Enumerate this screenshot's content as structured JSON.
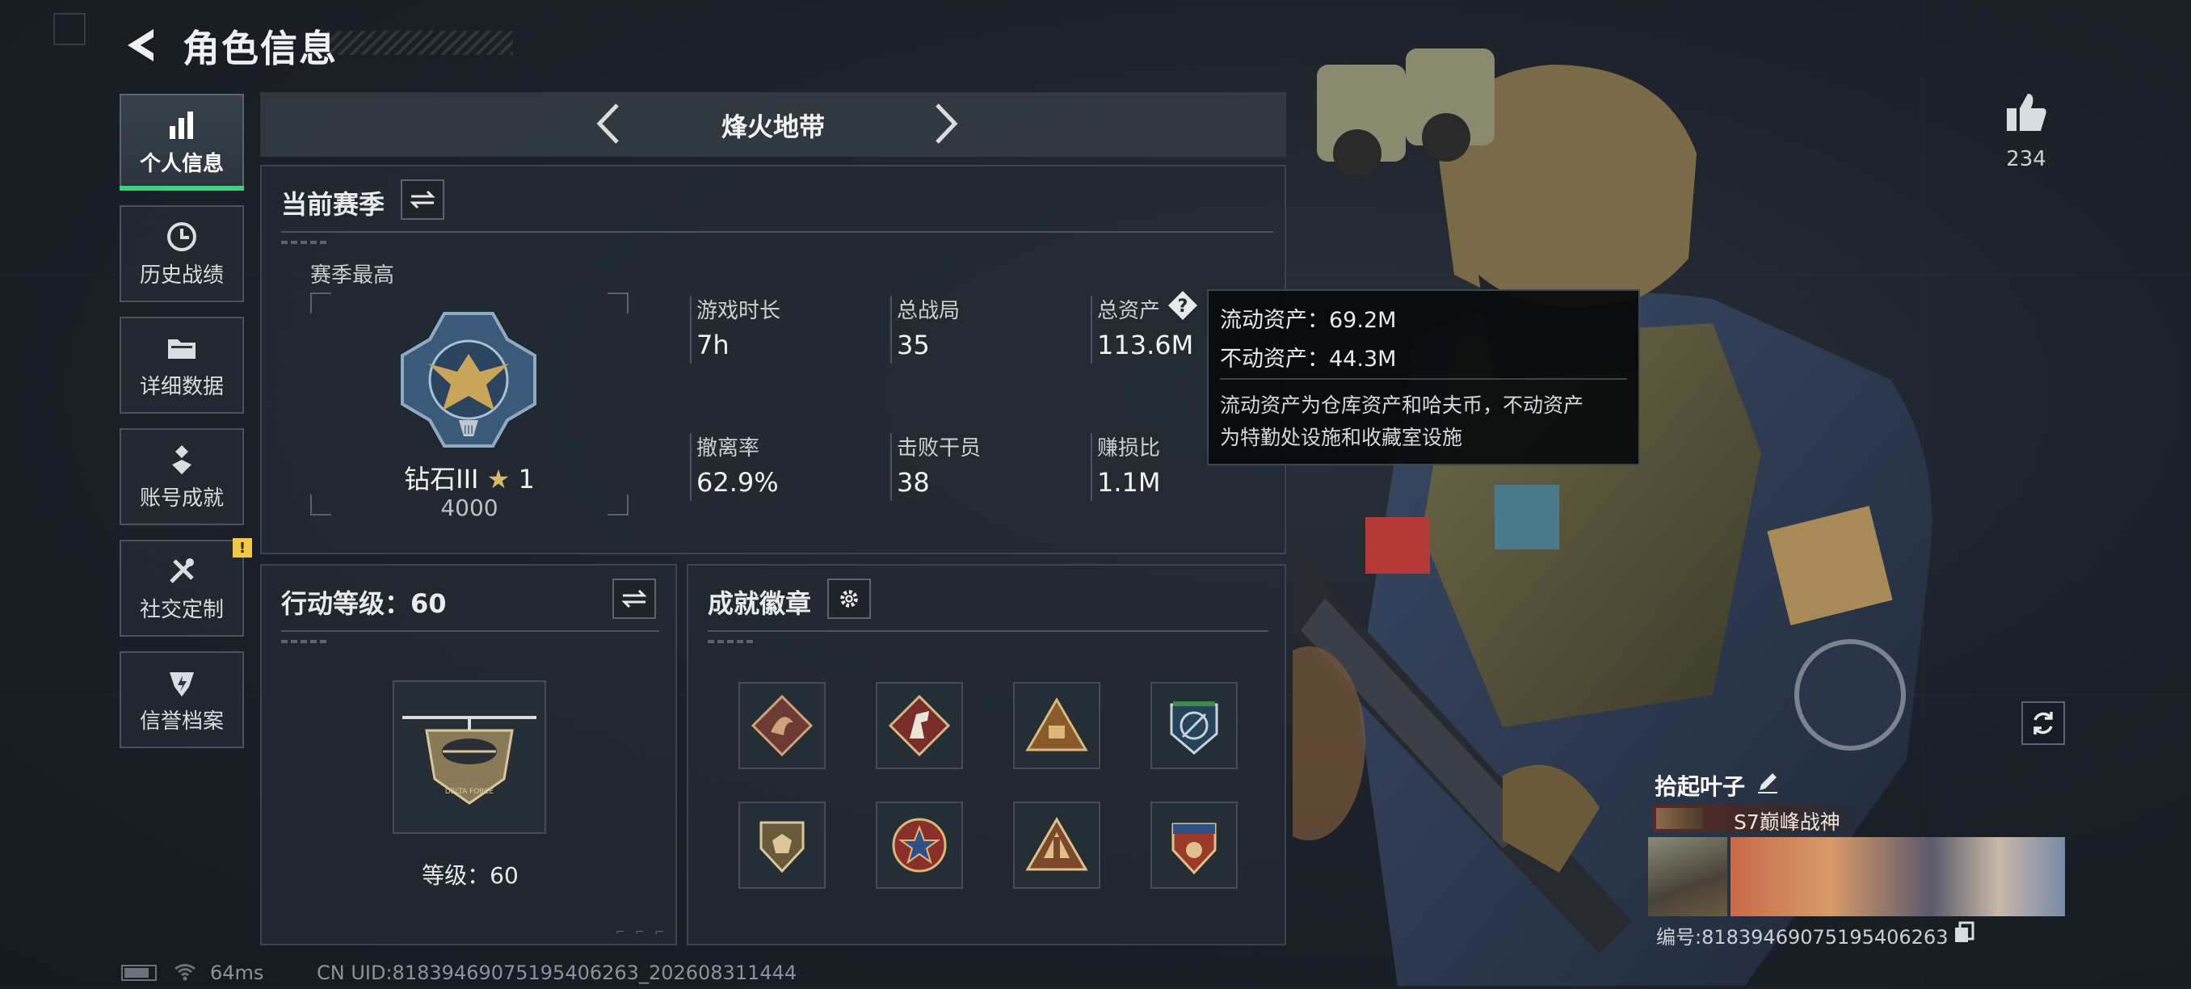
{
  "header": {
    "title": "角色信息"
  },
  "nav": [
    {
      "label": "个人信息",
      "icon": "bar-chart-icon",
      "active": true
    },
    {
      "label": "历史战绩",
      "icon": "clock-icon"
    },
    {
      "label": "详细数据",
      "icon": "folder-icon"
    },
    {
      "label": "账号成就",
      "icon": "achievement-icon"
    },
    {
      "label": "社交定制",
      "icon": "tools-icon",
      "badge": "!"
    },
    {
      "label": "信誉档案",
      "icon": "shield-bolt-icon"
    }
  ],
  "mode": {
    "name": "烽火地带"
  },
  "season": {
    "title": "当前赛季",
    "best_label": "赛季最高",
    "rank_name": "钻石III",
    "rank_stars": "1",
    "rank_score": "4000",
    "stats": [
      {
        "label": "游戏时长",
        "value": "7h"
      },
      {
        "label": "总战局",
        "value": "35"
      },
      {
        "label": "总资产",
        "value": "113.6M"
      },
      {
        "label": "撤离率",
        "value": "62.9%"
      },
      {
        "label": "击败干员",
        "value": "38"
      },
      {
        "label": "赚损比",
        "value": "1.1M"
      }
    ],
    "help_icon": "?"
  },
  "tooltip": {
    "line1": "流动资产：69.2M",
    "line2": "不动资产：44.3M",
    "desc1": "流动资产为仓库资产和哈夫币，不动资产",
    "desc2": "为特勤处设施和收藏室设施"
  },
  "action_level": {
    "title": "行动等级：60",
    "level_text": "等级：60",
    "emblem_text": "DELTA FORCE"
  },
  "achievements": {
    "title": "成就徽章",
    "badges": [
      "dragon-badge-icon",
      "horse-badge-icon",
      "triangle-badge-icon",
      "globe-badge-icon",
      "shield-badge-icon",
      "star-badge-icon",
      "peak-badge-icon",
      "crest-badge-icon"
    ]
  },
  "likes": {
    "count": "234"
  },
  "player": {
    "name": "拾起叶子",
    "title_tag": "S7巅峰战神",
    "id_text": "编号:81839469075195406263"
  },
  "status": {
    "ping": "64ms",
    "uid": "CN UID:81839469075195406263_202608311444"
  },
  "colors": {
    "accent_green": "#3fd27f",
    "warning_yellow": "#f2c744",
    "panel_bg": "#222a32"
  }
}
